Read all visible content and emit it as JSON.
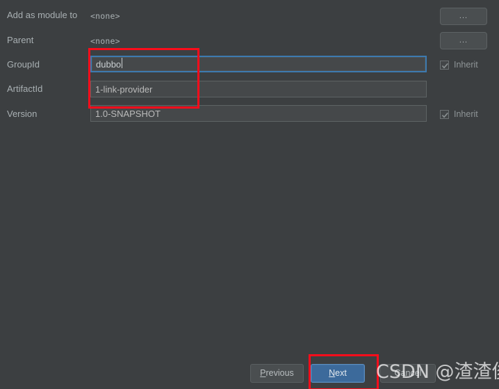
{
  "dialog": {
    "theme_background": "#3c3f41",
    "accent": "#3c6a9b",
    "annotation_color": "#fb0d1b"
  },
  "form": {
    "rows": [
      {
        "label": "Add as module to",
        "value": "<none>",
        "type": "static",
        "browse_label": "..."
      },
      {
        "label": "Parent",
        "value": "<none>",
        "type": "static",
        "browse_label": "..."
      },
      {
        "label": "GroupId",
        "value": "dubbo",
        "type": "input",
        "focused": true,
        "inherit_label": "Inherit",
        "inherit_checked": true
      },
      {
        "label": "ArtifactId",
        "value": "1-link-provider",
        "type": "input",
        "focused": false
      },
      {
        "label": "Version",
        "value": "1.0-SNAPSHOT",
        "type": "input",
        "focused": false,
        "inherit_label": "Inherit",
        "inherit_checked": true
      }
    ]
  },
  "footer": {
    "previous_label": "Previous",
    "previous_mnemonic": "P",
    "next_label": "Next",
    "next_mnemonic": "N",
    "cancel_label": "Cancel"
  },
  "watermark": {
    "text": "CSDN @渣渣俊"
  }
}
